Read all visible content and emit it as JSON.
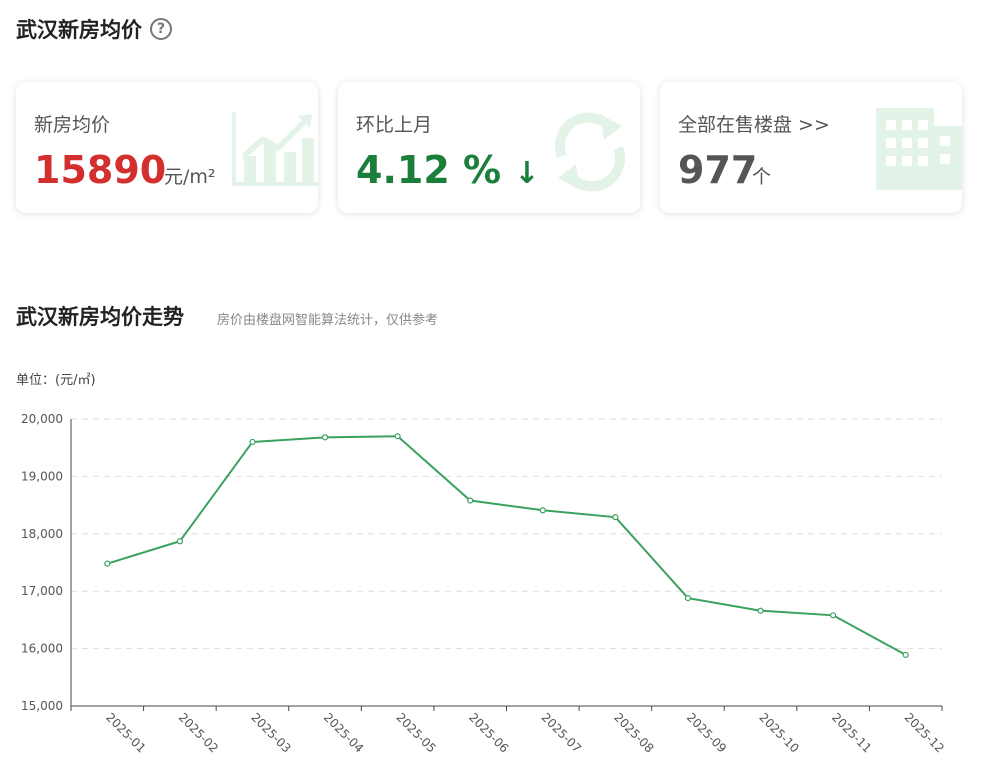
{
  "header": {
    "title": "武汉新房均价",
    "help_icon": "question-circle-icon"
  },
  "cards": [
    {
      "label": "新房均价",
      "value": "15890",
      "unit": "元/m²",
      "value_color": "#d32f2f",
      "icon": "rising-chart-icon"
    },
    {
      "label": "环比上月",
      "value": "4.12 %",
      "arrow": "↓",
      "value_color": "#1b7f3b",
      "icon": "refresh-arrows-icon"
    },
    {
      "label": "全部在售楼盘 >>",
      "value": "977",
      "unit": "个",
      "value_color": "#555555",
      "icon": "building-icon"
    }
  ],
  "trend": {
    "title": "武汉新房均价走势",
    "subtitle": "房价由楼盘网智能算法统计，仅供参考",
    "unit_label": "单位：(元/㎡)"
  },
  "chart_data": {
    "type": "line",
    "categories": [
      "2025-01",
      "2025-02",
      "2025-03",
      "2025-04",
      "2025-05",
      "2025-06",
      "2025-07",
      "2025-08",
      "2025-09",
      "2025-10",
      "2025-11",
      "2025-12"
    ],
    "series": [
      {
        "values": [
          17480,
          17870,
          19600,
          19680,
          19700,
          18580,
          18410,
          18290,
          16880,
          16660,
          16580,
          15890
        ]
      }
    ],
    "ylim": [
      15000,
      20000
    ],
    "yticks": [
      "20,000",
      "19,000",
      "18,000",
      "17,000",
      "16,000",
      "15,000"
    ],
    "line_color": "#3aa15f",
    "grid": true
  }
}
